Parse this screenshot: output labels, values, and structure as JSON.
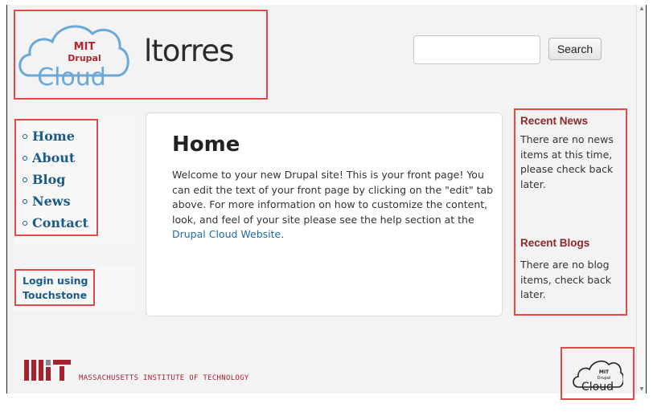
{
  "header": {
    "logo_text_top": "MIT",
    "logo_text_mid": "Drupal",
    "logo_text_main": "Cloud",
    "site_name": "ltorres"
  },
  "search": {
    "value": "",
    "placeholder": "",
    "button_label": "Search"
  },
  "nav": {
    "items": [
      {
        "label": "Home"
      },
      {
        "label": "About"
      },
      {
        "label": "Blog"
      },
      {
        "label": "News"
      },
      {
        "label": "Contact"
      }
    ]
  },
  "login": {
    "line1": "Login using",
    "line2": "Touchstone"
  },
  "main": {
    "title": "Home",
    "body_text": "Welcome to your new Drupal site! This is your front page! You can edit the text of your front page by clicking on the \"edit\" tab above. For more information on how to customize the content, look, and feel of your site please see the help section at the ",
    "link_text": "Drupal Cloud Website",
    "body_end": "."
  },
  "sidebar": {
    "news_title": "Recent News",
    "news_text": "There are no news items at this time, please check back later.",
    "blogs_title": "Recent Blogs",
    "blogs_text": "There are no blog items, check back later."
  },
  "footer": {
    "institute_name": "MASSACHUSETTS INSTITUTE OF TECHNOLOGY",
    "mit_mark": "MIT",
    "cloud_top": "MIT",
    "cloud_mid": "Drupal",
    "cloud_main": "Cloud"
  },
  "colors": {
    "link": "#1a5c87",
    "accent_red": "#a3232f",
    "annotation_red": "#e24a4a",
    "cloud_blue": "#6aa8d8"
  }
}
